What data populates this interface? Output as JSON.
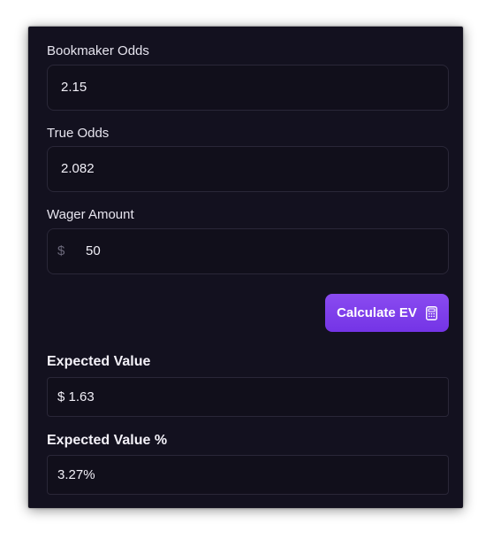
{
  "form": {
    "bookmaker_odds": {
      "label": "Bookmaker Odds",
      "value": "2.15"
    },
    "true_odds": {
      "label": "True Odds",
      "value": "2.082"
    },
    "wager_amount": {
      "label": "Wager Amount",
      "prefix": "$",
      "value": "50"
    }
  },
  "actions": {
    "calculate_label": "Calculate EV",
    "calculate_icon": "calculator-icon"
  },
  "results": {
    "expected_value": {
      "label": "Expected Value",
      "value": "$ 1.63"
    },
    "expected_value_pct": {
      "label": "Expected Value %",
      "value": "3.27%"
    }
  },
  "colors": {
    "panel_bg": "#13111f",
    "field_border": "#2a2738",
    "accent": "#7c3aed"
  }
}
